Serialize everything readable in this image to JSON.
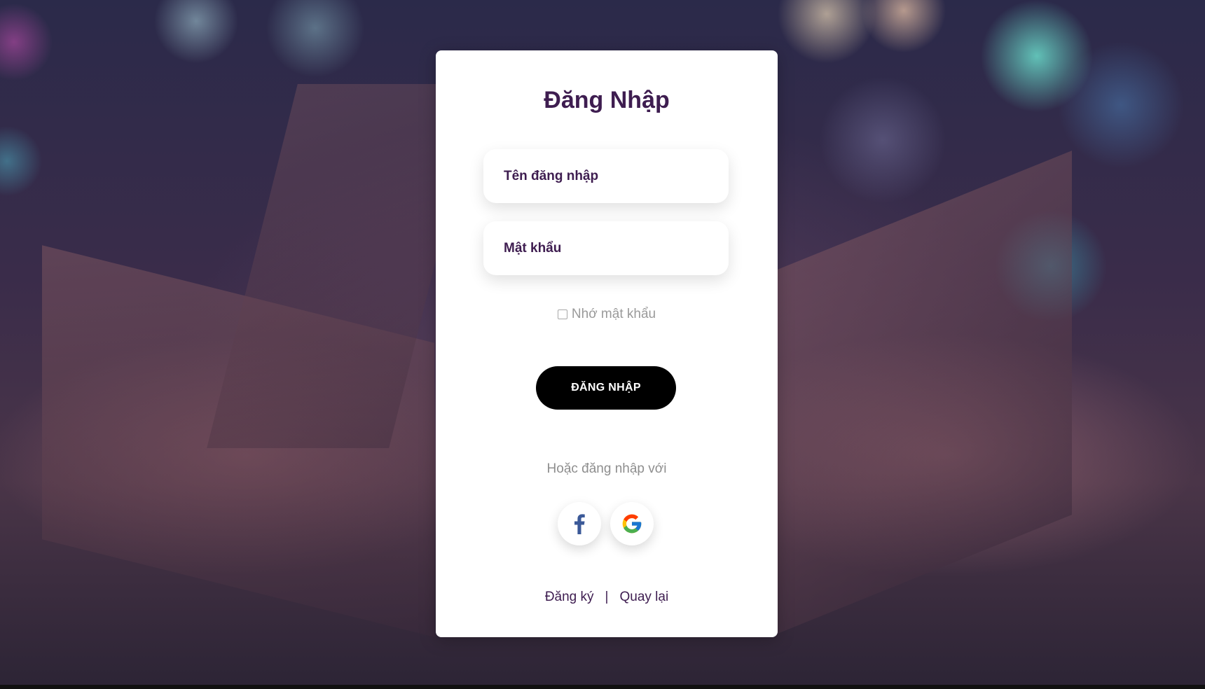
{
  "login": {
    "title": "Đăng Nhập",
    "username_placeholder": "Tên đăng nhập",
    "password_placeholder": "Mật khẩu",
    "remember_label": "Nhớ mật khẩu",
    "login_button": "ĐĂNG NHẬP",
    "or_text": "Hoặc đăng nhập với",
    "social": [
      {
        "name": "facebook",
        "icon": "facebook-icon",
        "color": "#3b5998"
      },
      {
        "name": "google",
        "icon": "google-icon"
      }
    ],
    "links": {
      "register": "Đăng ký",
      "separator": "|",
      "back": "Quay lại"
    }
  },
  "colors": {
    "accent": "#3e1d50",
    "button": "#000000",
    "muted_text": "#9a9a9a"
  }
}
